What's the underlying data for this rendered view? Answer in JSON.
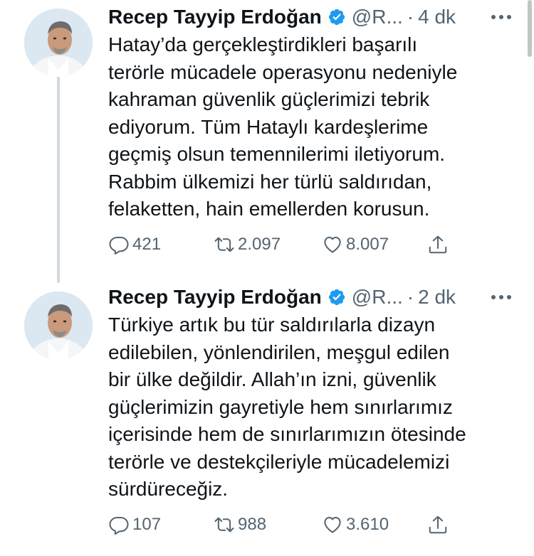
{
  "tweets": [
    {
      "author_name": "Recep Tayyip Erdoğan",
      "handle": "@R...",
      "separator": "·",
      "time": "4 dk",
      "text": "Hatay’da gerçekleştirdikleri başarılı\nterörle mücadele operasyonu nedeniyle\nkahraman güvenlik güçlerimizi tebrik\nediyorum. Tüm Hataylı kardeşlerime\ngeçmiş olsun temennilerimi iletiyorum.\nRabbim ülkemizi her türlü saldırıdan,\nfelaketten, hain emellerden korusun.",
      "replies": "421",
      "retweets": "2.097",
      "likes": "8.007"
    },
    {
      "author_name": "Recep Tayyip Erdoğan",
      "handle": "@R...",
      "separator": "·",
      "time": "2 dk",
      "text": "Türkiye artık bu tür saldırılarla dizayn\nedilebilen, yönlendirilen, meşgul edilen\nbir ülke değildir. Allah’ın izni, güvenlik\ngüçlerimizin gayretiyle hem sınırlarımız\niçerisinde hem de sınırlarımızın ötesinde\nterörle ve destekçileriyle mücadelemizi\nsürdüreceğiz.",
      "replies": "107",
      "retweets": "988",
      "likes": "3.610"
    }
  ],
  "icons": {
    "verified": "verified-badge-icon",
    "more": "more-options-icon",
    "reply": "reply-icon",
    "retweet": "retweet-icon",
    "like": "like-icon",
    "share": "share-icon"
  },
  "colors": {
    "verified_blue": "#1d9bf0",
    "secondary_text": "#536471",
    "primary_text": "#0f1419",
    "thread_line": "#cfd9de"
  }
}
